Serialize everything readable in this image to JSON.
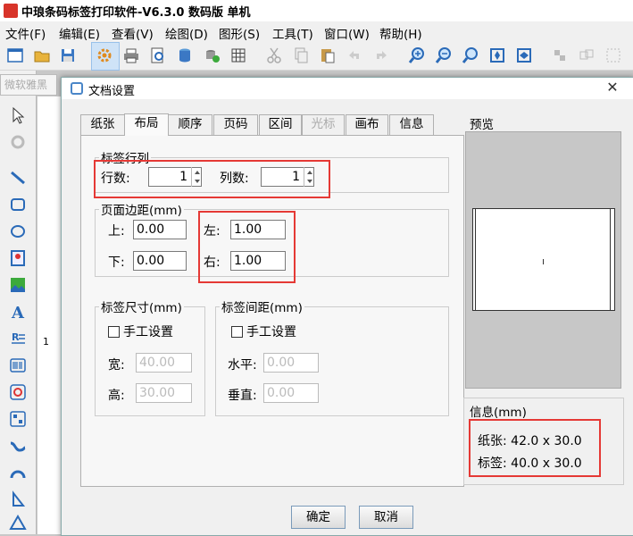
{
  "app": {
    "title": "中琅条码标签打印软件-V6.3.0 数码版 单机"
  },
  "menu": [
    "文件(F)",
    "编辑(E)",
    "查看(V)",
    "绘图(D)",
    "图形(S)",
    "工具(T)",
    "窗口(W)",
    "帮助(H)"
  ],
  "font_box": "微软雅黑",
  "dialog": {
    "title": "文档设置",
    "close_label": "✕",
    "tabs": [
      {
        "label": "纸张",
        "state": "normal"
      },
      {
        "label": "布局",
        "state": "active"
      },
      {
        "label": "顺序",
        "state": "normal"
      },
      {
        "label": "页码",
        "state": "normal"
      },
      {
        "label": "区间",
        "state": "normal"
      },
      {
        "label": "光标",
        "state": "disabled"
      },
      {
        "label": "画布",
        "state": "normal"
      },
      {
        "label": "信息",
        "state": "normal"
      }
    ],
    "layout": {
      "rows_cols_group": "标签行列",
      "rows_label": "行数:",
      "rows_value": "1",
      "cols_label": "列数:",
      "cols_value": "1",
      "margin_group": "页面边距(mm)",
      "top_label": "上:",
      "top_value": "0.00",
      "bottom_label": "下:",
      "bottom_value": "0.00",
      "left_label": "左:",
      "left_value": "1.00",
      "right_label": "右:",
      "right_value": "1.00",
      "size_group": "标签尺寸(mm)",
      "size_manual": "手工设置",
      "width_label": "宽:",
      "width_value": "40.00",
      "height_label": "高:",
      "height_value": "30.00",
      "gap_group": "标签间距(mm)",
      "gap_manual": "手工设置",
      "hgap_label": "水平:",
      "hgap_value": "0.00",
      "vgap_label": "垂直:",
      "vgap_value": "0.00"
    },
    "preview_label": "预览",
    "info": {
      "title": "信息(mm)",
      "paper": "纸张: 42.0 x 30.0",
      "label": "标签: 40.0 x 30.0"
    },
    "ok_label": "确定",
    "cancel_label": "取消"
  },
  "ruler_mark": "1",
  "colors": {
    "highlight_red": "#e53935",
    "accent_blue": "#4a86c8"
  }
}
